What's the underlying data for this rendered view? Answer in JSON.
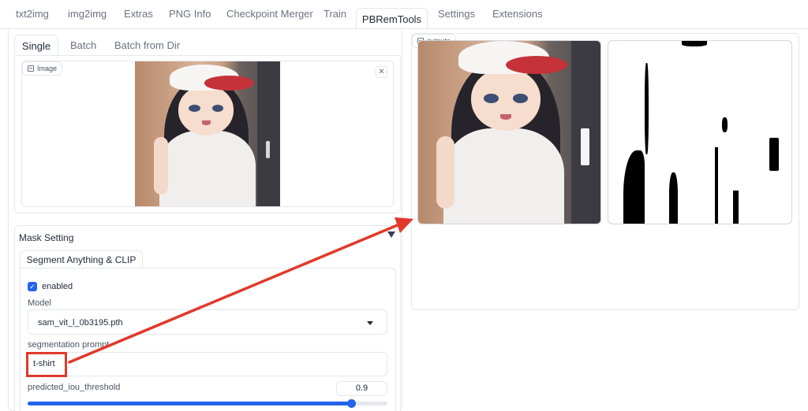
{
  "top_tabs": [
    "txt2img",
    "img2img",
    "Extras",
    "PNG Info",
    "Checkpoint Merger",
    "Train",
    "PBRemTools",
    "Settings",
    "Extensions"
  ],
  "active_top_tab": "PBRemTools",
  "sub_tabs": [
    "Single",
    "Batch",
    "Batch from Dir"
  ],
  "image_panel": {
    "label": "Image",
    "clear_icon": "close-icon"
  },
  "outputs_panel": {
    "label": "outputs"
  },
  "mask_setting": {
    "title": "Mask Setting",
    "collapse_icon": "triangle-down-icon",
    "tab": "Segment Anything & CLIP",
    "enabled_label": "enabled",
    "enabled": true,
    "model_label": "Model",
    "model_value": "sam_vit_l_0b3195.pth",
    "prompt_label": "segmentation prompt",
    "prompt_value": "t-shirt",
    "iou_label": "predicted_iou_threshold",
    "iou_value": "0.9",
    "iou_fraction": 0.9
  },
  "colors": {
    "accent": "#2563eb",
    "highlight": "#e0392b"
  }
}
